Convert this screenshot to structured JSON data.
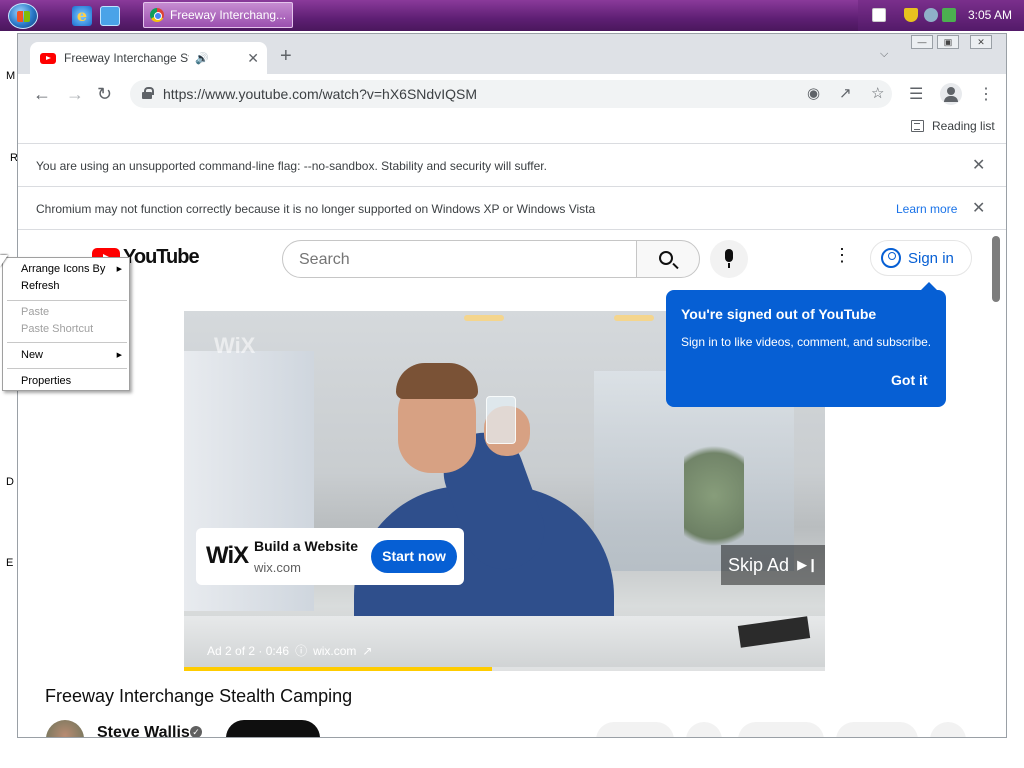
{
  "taskbar": {
    "task_button_label": "Freeway Interchang...",
    "clock": "3:05 AM"
  },
  "desktop": {
    "labels": [
      "M",
      "R",
      "D",
      "E"
    ]
  },
  "browser": {
    "tab_title": "Freeway Interchange Stealth Camping",
    "url": "https://www.youtube.com/watch?v=hX6SNdvIQSM",
    "reading_list_label": "Reading list",
    "infobar_sandbox": "You are using an unsupported command-line flag: --no-sandbox. Stability and security will suffer.",
    "infobar_xp": "Chromium may not function correctly because it is no longer supported on Windows XP or Windows Vista",
    "learn_more": "Learn more"
  },
  "youtube": {
    "logo_text": "YouTube",
    "search_placeholder": "Search",
    "sign_in": "Sign in",
    "tooltip": {
      "title": "You're signed out of YouTube",
      "body": "Sign in to like videos, comment, and subscribe.",
      "action": "Got it"
    },
    "video": {
      "watermark": "WiX",
      "ad_logo": "WiX",
      "ad_title": "Build a Website",
      "ad_url": "wix.com",
      "ad_cta": "Start now",
      "skip_label": "Skip Ad",
      "ad_counter": "Ad 2 of 2 · 0:46",
      "ad_domain": "wix.com",
      "ad_progress_fraction": 0.48
    },
    "video_title": "Freeway Interchange Stealth Camping",
    "channel_name": "Steve Wallis"
  },
  "context_menu": {
    "items": [
      {
        "label": "Arrange Icons By",
        "enabled": true,
        "submenu": true
      },
      {
        "label": "Refresh",
        "enabled": true,
        "submenu": false
      },
      {
        "label": "Paste",
        "enabled": false,
        "submenu": false
      },
      {
        "label": "Paste Shortcut",
        "enabled": false,
        "submenu": false
      },
      {
        "label": "New",
        "enabled": true,
        "submenu": true
      },
      {
        "label": "Properties",
        "enabled": true,
        "submenu": false
      }
    ]
  },
  "colors": {
    "taskbar": "#5e1f74",
    "youtube_red": "#ff0000",
    "youtube_blue": "#065fd4",
    "link_blue": "#1a73e8",
    "ad_progress": "#ffcc00"
  }
}
